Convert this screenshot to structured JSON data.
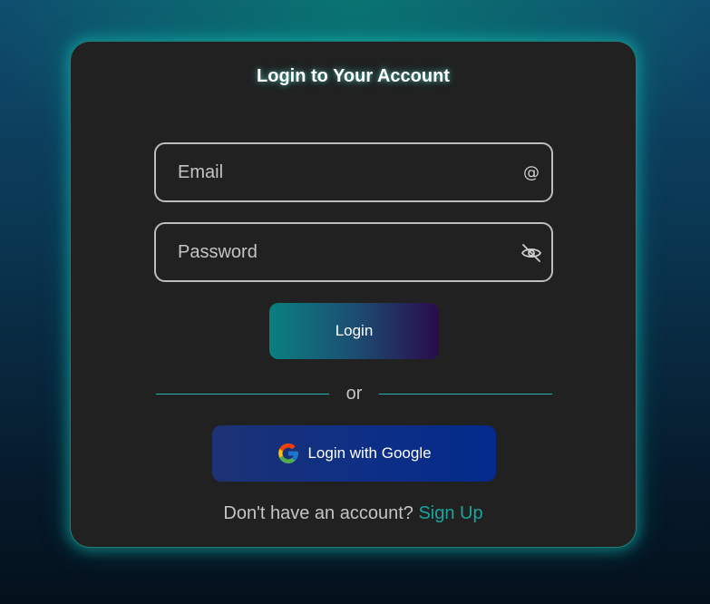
{
  "login_form": {
    "title": "Login to Your Account",
    "email": {
      "placeholder": "Email",
      "value": "",
      "icon": "at-sign-icon"
    },
    "password": {
      "placeholder": "Password",
      "value": "",
      "icon": "eye-off-icon"
    },
    "login_button_label": "Login",
    "divider_text": "or",
    "google_button": {
      "label": "Login with Google",
      "icon": "google-logo-icon"
    },
    "signup": {
      "prompt": "Don't have an account?",
      "link_label": "Sign Up"
    }
  },
  "colors": {
    "card_background": "#212121",
    "accent_teal": "#1aa49d",
    "login_gradient_start": "#0b7f80",
    "login_gradient_end": "#2a0b4c",
    "google_button": "#0d2f86",
    "field_border": "#bdbdbd"
  }
}
